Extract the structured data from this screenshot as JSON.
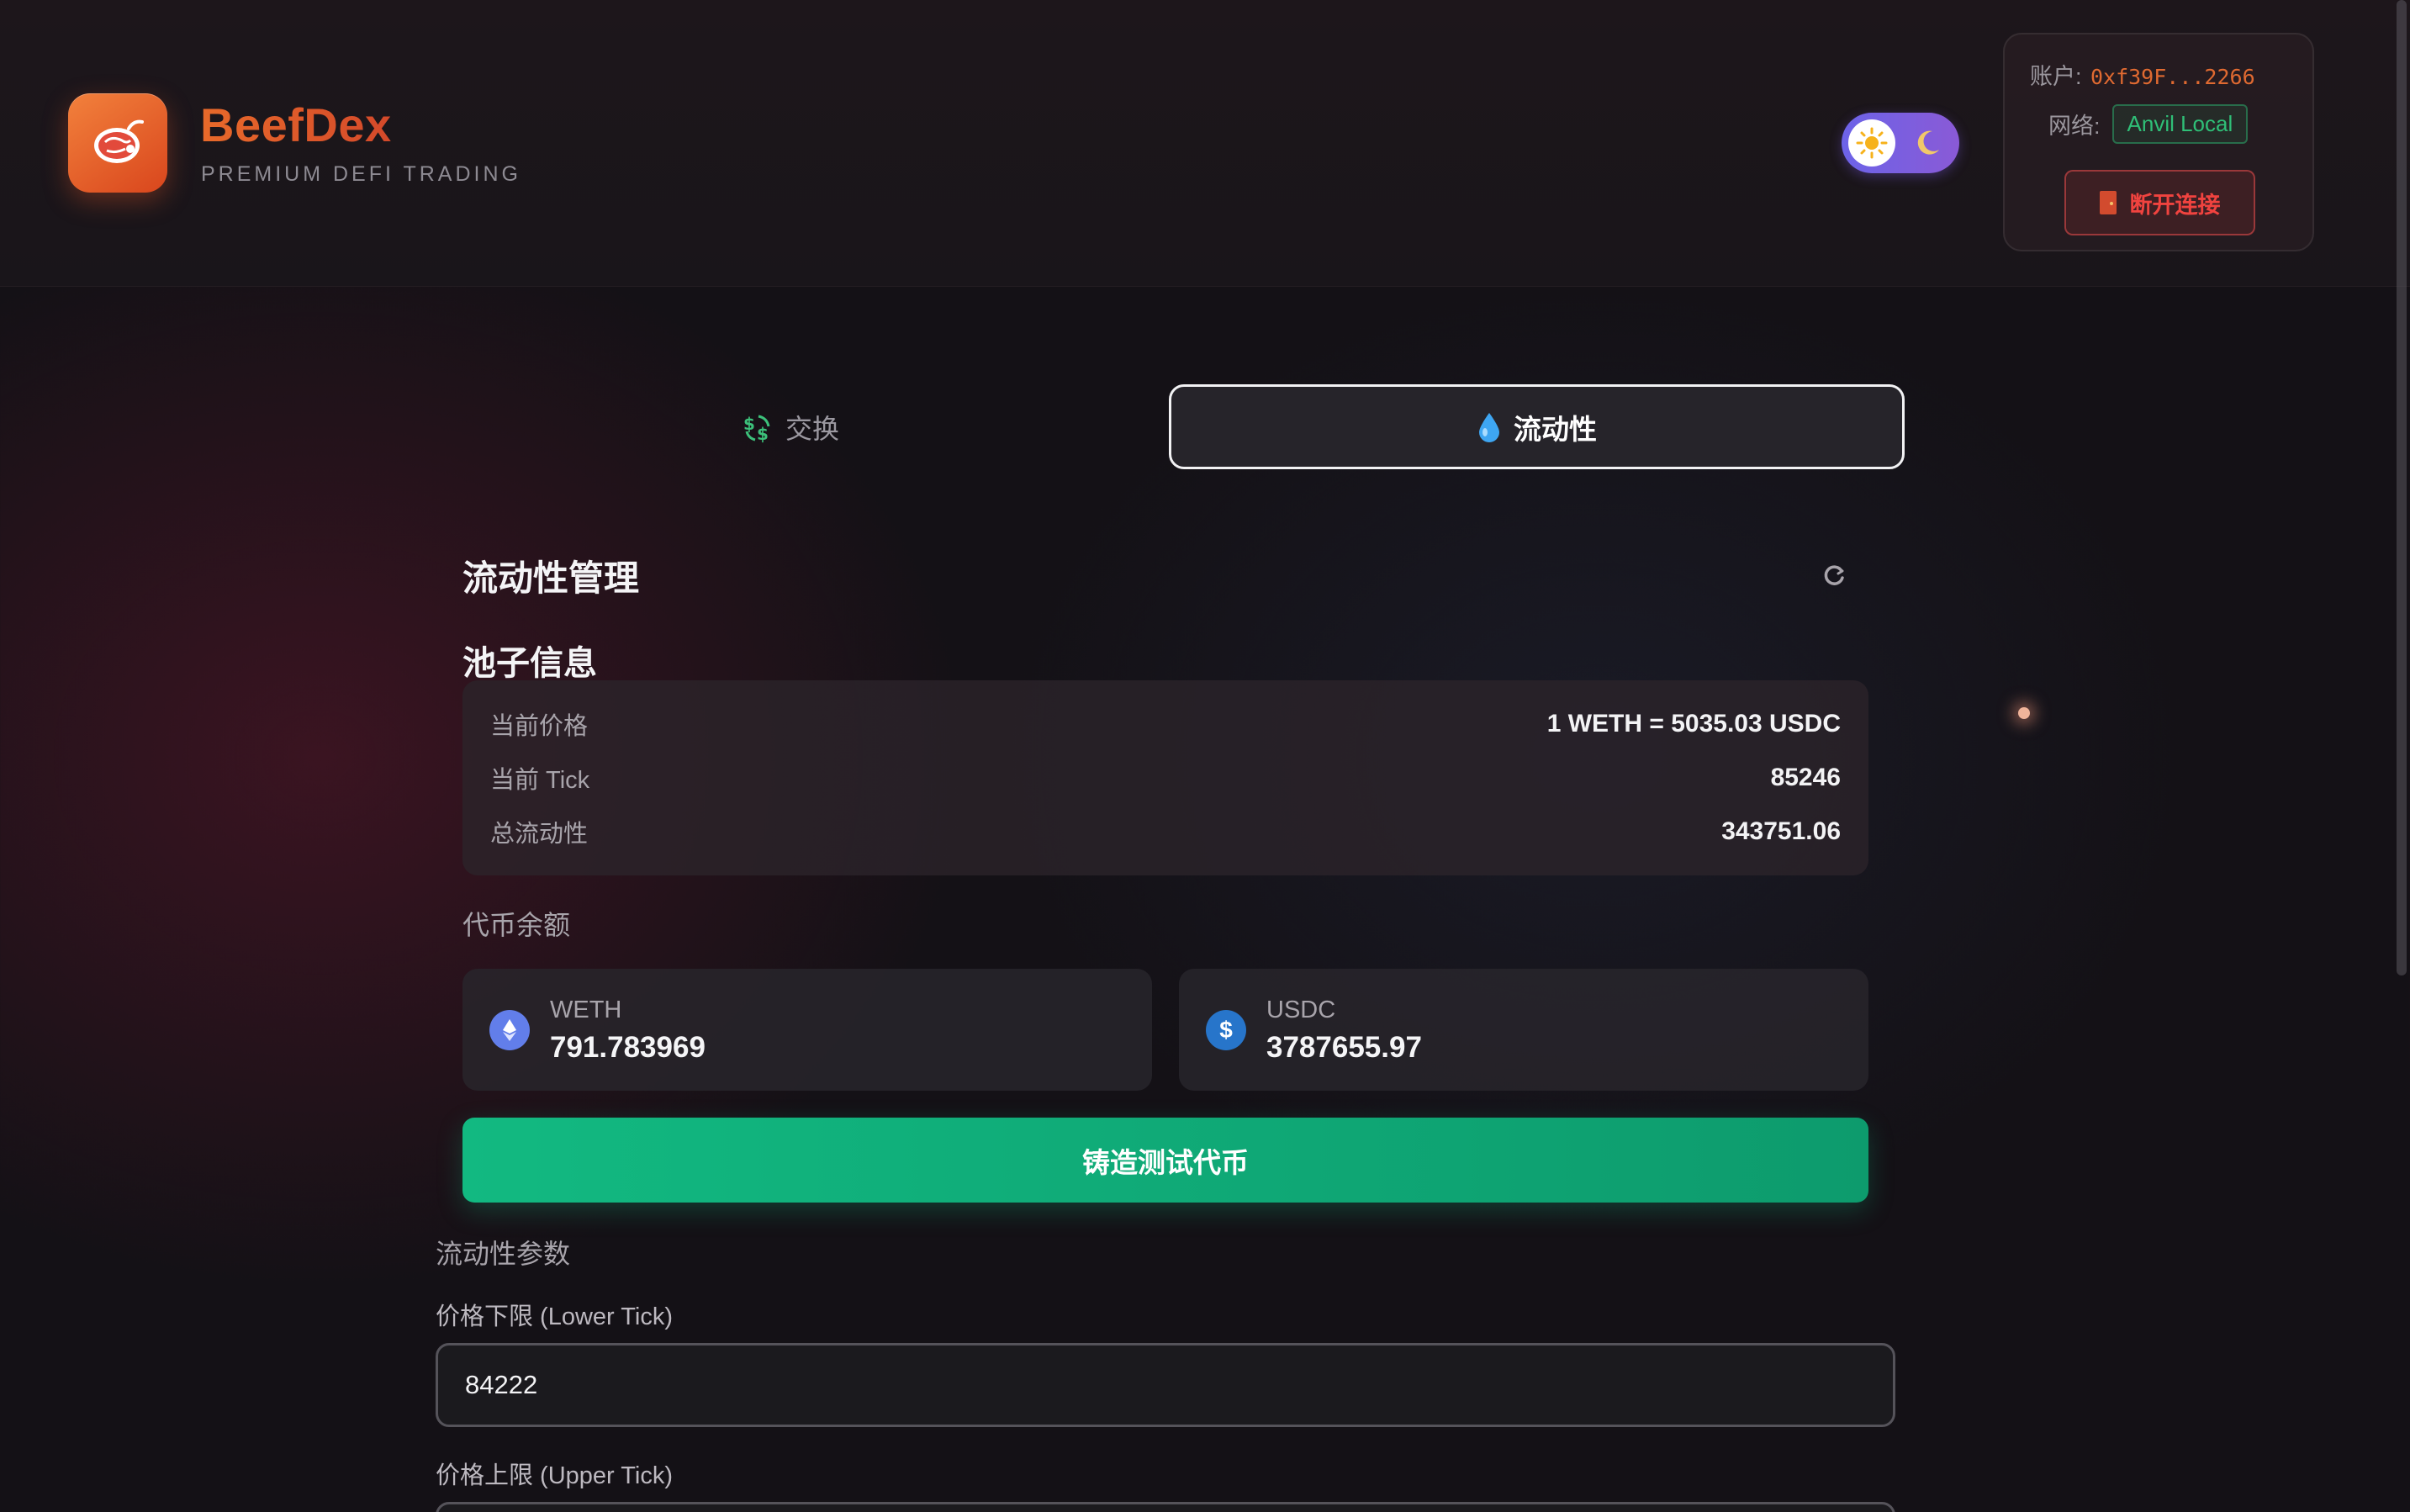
{
  "brand": {
    "name": "BeefDex",
    "tagline": "PREMIUM DEFI TRADING",
    "logo_icon": "meat-icon"
  },
  "theme_toggle": {
    "left_icon": "sun-icon",
    "right_icon": "moon-icon",
    "mode": "dark"
  },
  "account": {
    "account_label": "账户:",
    "address": "0xf39F...2266",
    "network_label": "网络:",
    "network": "Anvil Local",
    "disconnect_label": "断开连接"
  },
  "tabs": [
    {
      "label": "交换",
      "icon": "currency-exchange-icon",
      "active": false
    },
    {
      "label": "流动性",
      "icon": "droplet-icon",
      "active": true
    }
  ],
  "liquidity": {
    "title": "流动性管理",
    "pool_info_title": "池子信息",
    "pool_info": [
      {
        "key": "当前价格",
        "value": "1 WETH = 5035.03 USDC"
      },
      {
        "key": "当前 Tick",
        "value": "85246"
      },
      {
        "key": "总流动性",
        "value": "343751.06"
      }
    ],
    "balances_label": "代币余额",
    "balances": [
      {
        "symbol": "WETH",
        "amount": "791.783969",
        "icon": "ethereum-icon"
      },
      {
        "symbol": "USDC",
        "amount": "3787655.97",
        "icon": "dollar-icon"
      }
    ],
    "mint_button": "铸造测试代币",
    "params_label": "流动性参数",
    "lower_tick_label": "价格下限 (Lower Tick)",
    "lower_tick_value": "84222",
    "upper_tick_label": "价格上限 (Upper Tick)"
  },
  "colors": {
    "accent_orange": "#e86a2a",
    "mint_green": "#12b981",
    "disconnect_red": "#f0433f",
    "network_green": "#2fbf77"
  }
}
